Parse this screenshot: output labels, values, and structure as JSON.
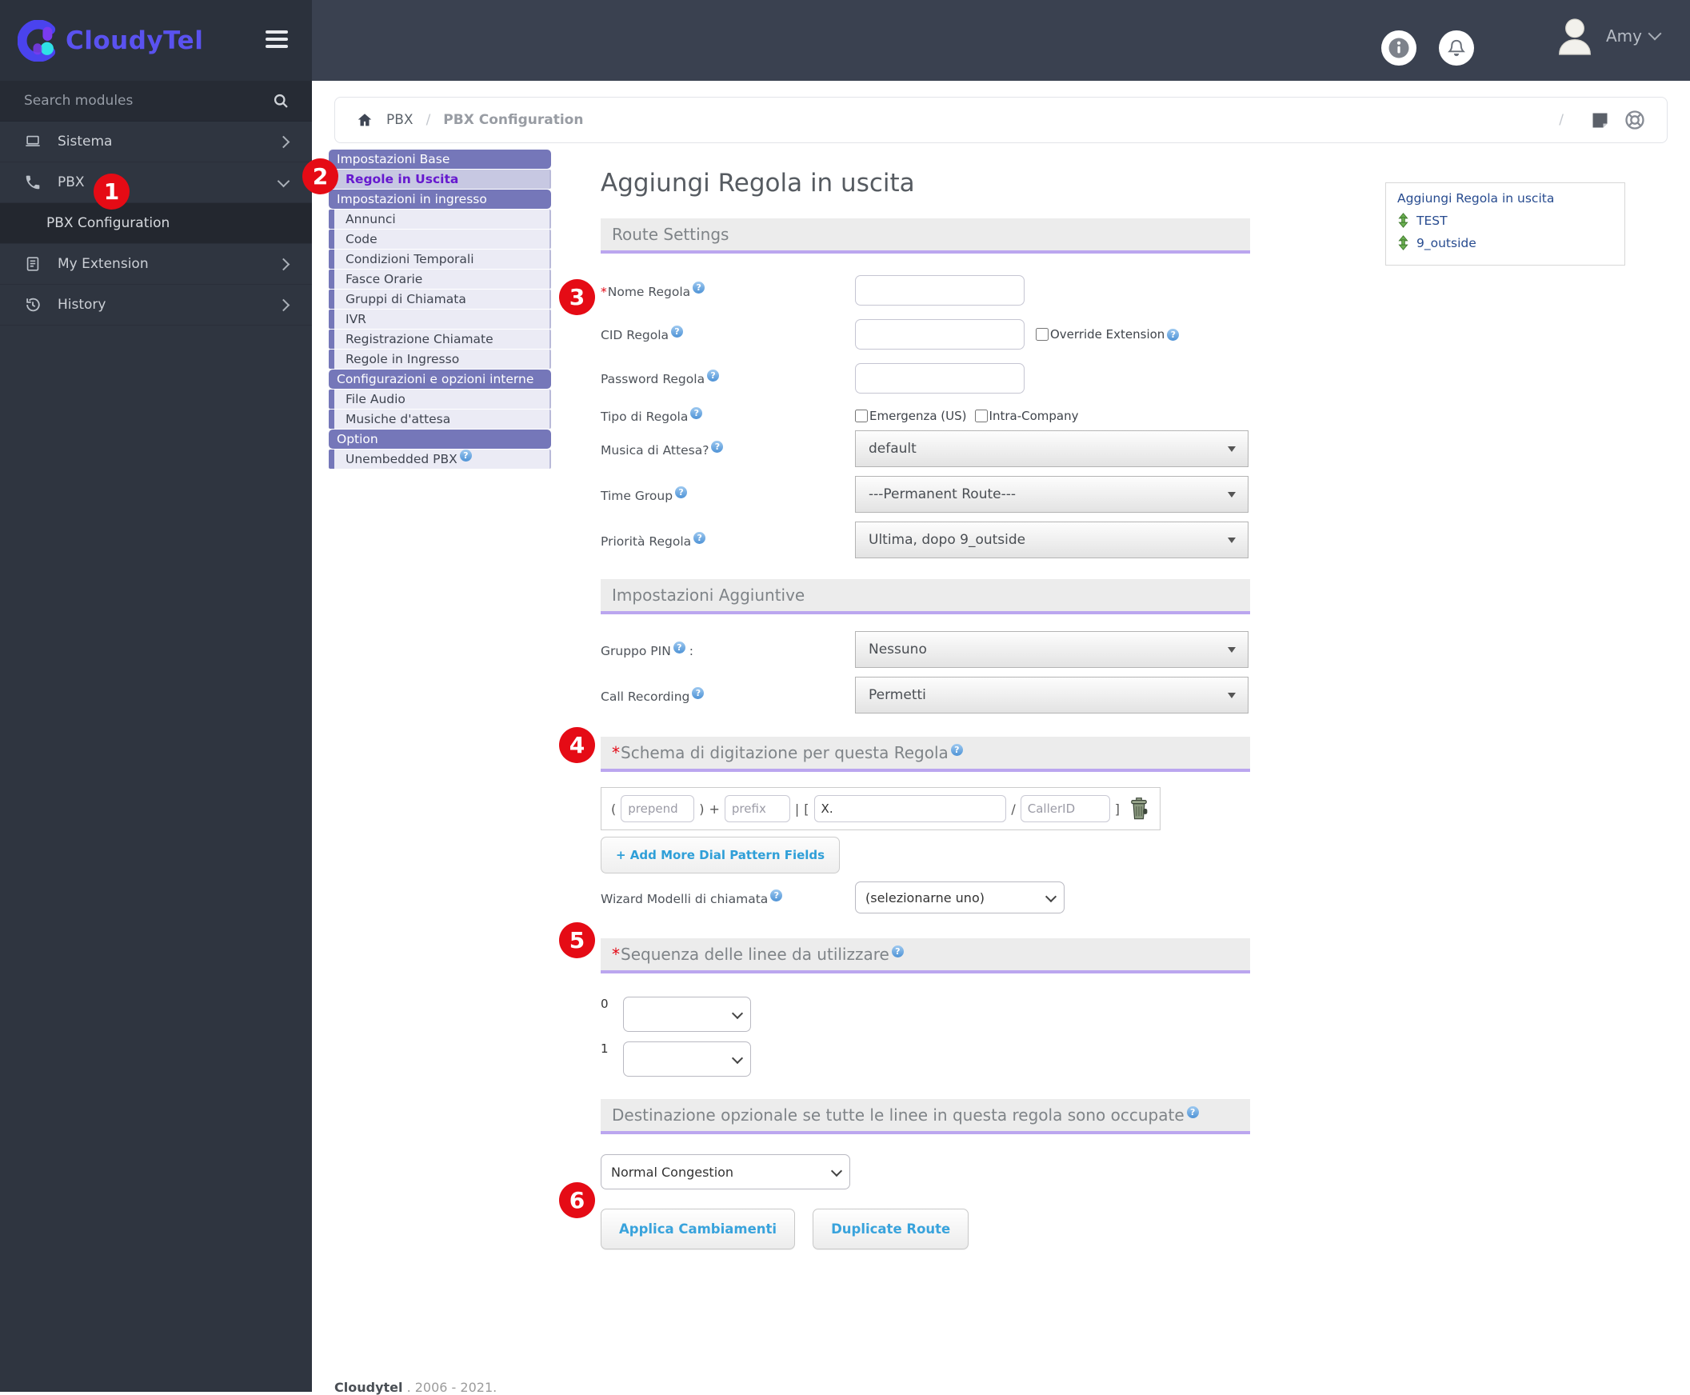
{
  "sidebar": {
    "brand": "CloudyTel",
    "search_placeholder": "Search modules",
    "nav": [
      {
        "label": "Sistema"
      },
      {
        "label": "PBX"
      },
      {
        "label": "PBX Configuration"
      },
      {
        "label": "My Extension"
      },
      {
        "label": "History"
      }
    ]
  },
  "topbar": {
    "user_name": "Amy"
  },
  "breadcrumb": {
    "home_section": "PBX",
    "separator": "/",
    "current": "PBX Configuration",
    "trailing_slash": "/"
  },
  "submenu": {
    "items": [
      {
        "label": "Impostazioni Base"
      },
      {
        "label": "Regole in Uscita"
      },
      {
        "label": "Impostazioni in ingresso"
      },
      {
        "label": "Annunci"
      },
      {
        "label": "Code"
      },
      {
        "label": "Condizioni Temporali"
      },
      {
        "label": "Fasce Orarie"
      },
      {
        "label": "Gruppi di Chiamata"
      },
      {
        "label": "IVR"
      },
      {
        "label": "Registrazione Chiamate"
      },
      {
        "label": "Regole in Ingresso"
      },
      {
        "label": "Configurazioni e opzioni interne"
      },
      {
        "label": "File Audio"
      },
      {
        "label": "Musiche d'attesa"
      },
      {
        "label": "Option"
      },
      {
        "label": "Unembedded PBX"
      }
    ]
  },
  "form": {
    "title": "Aggiungi Regola in uscita",
    "section_route": "Route Settings",
    "fields": {
      "nome_regola": {
        "label": "Nome Regola"
      },
      "cid_regola": {
        "label": "CID Regola",
        "checkbox_label": "Override Extension"
      },
      "password_regola": {
        "label": "Password Regola"
      },
      "tipo_di_regola": {
        "label": "Tipo di Regola",
        "checkbox1": "Emergenza (US)",
        "checkbox2": "Intra-Company"
      },
      "musica_di_attesa": {
        "label": "Musica di Attesa?",
        "value": "default"
      },
      "time_group": {
        "label": "Time Group",
        "value": "---Permanent Route---"
      },
      "priorita_regola": {
        "label": "Priorità Regola",
        "value": "Ultima, dopo 9_outside"
      }
    },
    "section_aggiuntive": "Impostazioni Aggiuntive",
    "fields2": {
      "gruppo_pin": {
        "label": "Gruppo PIN",
        "colon": ":",
        "value": "Nessuno"
      },
      "call_recording": {
        "label": "Call Recording",
        "value": "Permetti"
      }
    },
    "section_schema": "Schema di digitazione per questa Regola",
    "dial_pattern": {
      "symbols": {
        "open": "(",
        "close": ")",
        "plus": "+",
        "pipe": "|",
        "bracket_open": "[",
        "slash": "/",
        "bracket_close": "]"
      },
      "prepend_placeholder": "prepend",
      "prefix_placeholder": "prefix",
      "match_value": "X.",
      "callerid_placeholder": "CallerID",
      "add_button": "+ Add More Dial Pattern Fields"
    },
    "wizard": {
      "label": "Wizard Modelli di chiamata",
      "value": "(selezionarne uno)"
    },
    "section_sequenza": "Sequenza delle linee da utilizzare",
    "sequence_rows": [
      {
        "index": "0"
      },
      {
        "index": "1"
      }
    ],
    "section_destinazione": "Destinazione opzionale se tutte le linee in questa regola sono occupate",
    "destination_value": "Normal Congestion",
    "buttons": {
      "apply": "Applica Cambiamenti",
      "duplicate": "Duplicate Route"
    }
  },
  "right_panel": {
    "title": "Aggiungi Regola in uscita",
    "items": [
      {
        "label": "TEST"
      },
      {
        "label": "9_outside"
      }
    ]
  },
  "annotations": {
    "n1": "1",
    "n2": "2",
    "n3": "3",
    "n4": "4",
    "n5": "5",
    "n6": "6"
  },
  "footer": {
    "brand": "Cloudytel",
    "text": ". 2006 - 2021."
  }
}
